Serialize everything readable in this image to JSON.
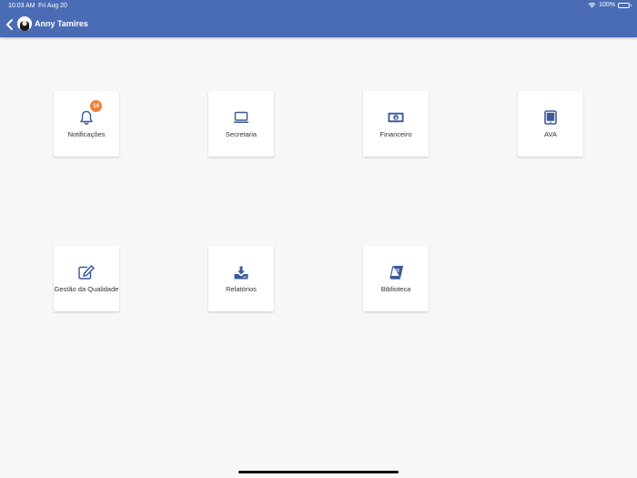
{
  "status_bar": {
    "time": "10:03 AM",
    "date": "Fri Aug 20",
    "battery": "100%"
  },
  "header": {
    "user_name": "Anny Tamires",
    "back_icon": "chevron-left-icon",
    "bg_color": "#4a6cb5"
  },
  "tiles": [
    {
      "label": "Notificações",
      "icon": "bell-icon",
      "badge": "14"
    },
    {
      "label": "Secretaria",
      "icon": "laptop-icon"
    },
    {
      "label": "Financeiro",
      "icon": "money-bill-icon"
    },
    {
      "label": "AVA",
      "icon": "tablet-icon"
    },
    {
      "label": "Gestão da Qualidade",
      "icon": "edit-icon"
    },
    {
      "label": "Relatórios",
      "icon": "download-icon"
    },
    {
      "label": "Biblioteca",
      "icon": "book-icon"
    }
  ],
  "colors": {
    "accent": "#4a6cb5",
    "badge": "#f07f3a",
    "icon": "#3d5a99"
  }
}
